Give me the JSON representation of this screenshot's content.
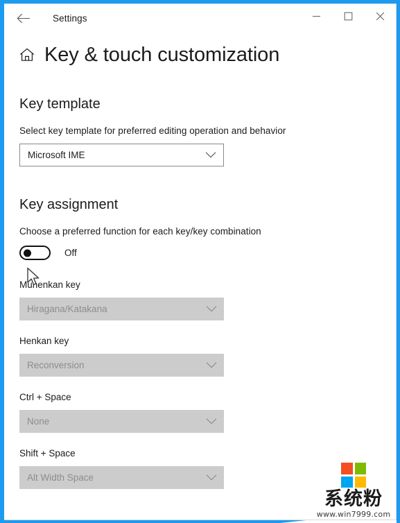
{
  "window": {
    "app_title": "Settings",
    "back_icon": "back-arrow-icon",
    "minimize_label": "—",
    "maximize_label": "□",
    "close_label": "✕"
  },
  "page": {
    "home_icon": "home-icon",
    "title": "Key & touch customization"
  },
  "key_template": {
    "heading": "Key template",
    "description": "Select key template for preferred editing operation and behavior",
    "dropdown_value": "Microsoft IME",
    "chevron_icon": "chevron-down-icon"
  },
  "key_assignment": {
    "heading": "Key assignment",
    "description": "Choose a preferred function for each key/key combination",
    "toggle_state_label": "Off",
    "fields": [
      {
        "label": "Muhenkan key",
        "value": "Hiragana/Katakana",
        "disabled": true
      },
      {
        "label": "Henkan key",
        "value": "Reconversion",
        "disabled": true
      },
      {
        "label": "Ctrl + Space",
        "value": "None",
        "disabled": true
      },
      {
        "label": "Shift + Space",
        "value": "Alt Width Space",
        "disabled": true
      }
    ]
  },
  "watermark": {
    "logo_name": "microsoft-logo",
    "tiles": [
      "#f25022",
      "#7fba00",
      "#00a4ef",
      "#ffb900"
    ],
    "brand_text": "系统粉",
    "url": "www.win7999.com"
  },
  "cursor": {
    "name": "mouse-pointer"
  },
  "colors": {
    "accent": "#1d9bf0",
    "text": "#1b1b1b",
    "disabled_bg": "#cccccc",
    "disabled_text": "#8d8d8d",
    "combo_border": "#8a8a8a"
  }
}
